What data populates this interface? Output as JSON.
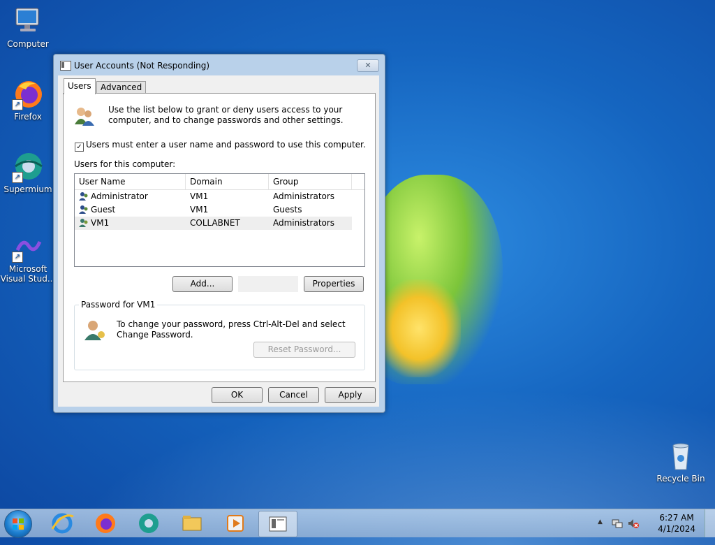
{
  "desktop": {
    "icons": [
      {
        "label": "Computer"
      },
      {
        "label": "Firefox"
      },
      {
        "label": "Supermium"
      },
      {
        "label": "Microsoft Visual Stud..."
      },
      {
        "label": "Recycle Bin"
      }
    ]
  },
  "dialog": {
    "title": "User Accounts (Not Responding)",
    "close_glyph": "✕",
    "tabs": [
      {
        "label": "Users"
      },
      {
        "label": "Advanced"
      }
    ],
    "intro_text": "Use the list below to grant or deny users access to your computer, and to change passwords and other settings.",
    "require_login": {
      "label": "Users must enter a user name and password to use this computer.",
      "checked": "✓"
    },
    "users_label": "Users for this computer:",
    "columns": [
      "User Name",
      "Domain",
      "Group"
    ],
    "users": [
      {
        "name": "Administrator",
        "domain": "VM1",
        "group": "Administrators"
      },
      {
        "name": "Guest",
        "domain": "VM1",
        "group": "Guests"
      },
      {
        "name": "VM1",
        "domain": "COLLABNET",
        "group": "Administrators"
      }
    ],
    "add_label": "Add...",
    "properties_label": "Properties",
    "password_group": {
      "legend": "Password for VM1",
      "text": "To change your password, press Ctrl-Alt-Del and select Change Password.",
      "reset_label": "Reset Password..."
    },
    "ok_label": "OK",
    "cancel_label": "Cancel",
    "apply_label": "Apply"
  },
  "taskbar": {
    "time": "6:27 AM",
    "date": "4/1/2024",
    "tray_expand": "▲"
  }
}
